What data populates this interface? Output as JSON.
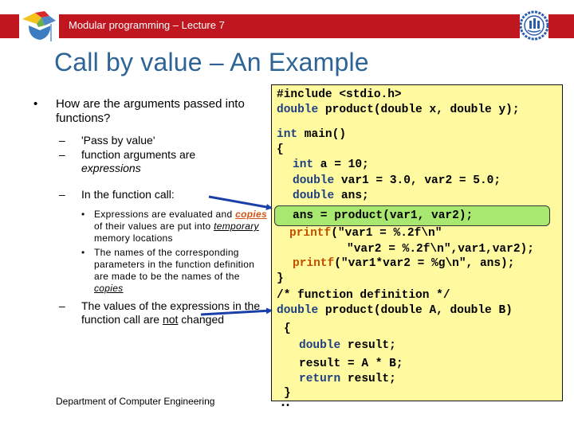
{
  "header": {
    "title": "Modular programming – Lecture 7",
    "band_color": "#c0161f",
    "left_logo_icon": "graduation-cap-puzzle-icon",
    "right_logo_icon": "university-seal-icon"
  },
  "slide": {
    "title": "Call by value – An Example",
    "title_color": "#2e6495",
    "footer": "Department of Computer Engineering"
  },
  "bullets": {
    "b1_bullet": "•",
    "b1_text": "How are the arguments passed into functions?",
    "dash": "–",
    "b2a_text": "'Pass by value'",
    "b2b_text": "function arguments are",
    "b2b_italic": "expressions",
    "b2c_text": "In the function call:",
    "b3_bullet": "•",
    "b3a_part1": "Expressions are evaluated and",
    "b3a_copies": "copies",
    "b3a_part2": " of their values are put into ",
    "b3a_temporary": "temporary",
    "b3a_part3": " memory locations",
    "b3b_text": "The names of the corresponding parameters in the function definition are made to be the names of the ",
    "b3b_copies": "copies",
    "b2d_part1": "The values of the expressions in the function call are ",
    "b2d_not": "not",
    "b2d_part2": " changed"
  },
  "code": {
    "box_color": "#fff9a0",
    "highlight_color": "#a8e870",
    "lines": [
      {
        "kw": "",
        "rest": "#include <stdio.h>"
      },
      {
        "kw": "double",
        "rest": " product(double x, double y);"
      },
      {
        "kw": "int",
        "rest": " main()"
      },
      {
        "kw": "",
        "rest": "{"
      },
      {
        "kw": "int",
        "rest": " a = 10;"
      },
      {
        "kw": "double",
        "rest": " var1 = 3.0, var2 = 5.0;"
      },
      {
        "kw": "double",
        "rest": " ans;"
      },
      {
        "kw": "",
        "rest": "ans = product(var1, var2);"
      },
      {
        "kw": "printf",
        "rest": "(\"var1 = %.2f\\n\""
      },
      {
        "kw": "",
        "rest": "\"var2 = %.2f\\n\",var1,var2);"
      },
      {
        "kw": "printf",
        "rest": "(\"var1*var2 = %g\\n\", ans);"
      },
      {
        "kw": "",
        "rest": "}"
      },
      {
        "kw": "",
        "rest": "/* function definition */"
      },
      {
        "kw": "double",
        "rest": " product(double A, double B)"
      },
      {
        "kw": "",
        "rest": "{"
      },
      {
        "kw": "double",
        "rest": " result;"
      },
      {
        "kw": "",
        "rest": "result = A * B;"
      },
      {
        "kw": "return",
        "rest": " result;"
      },
      {
        "kw": "",
        "rest": "}"
      }
    ],
    "stray_text": "••"
  }
}
